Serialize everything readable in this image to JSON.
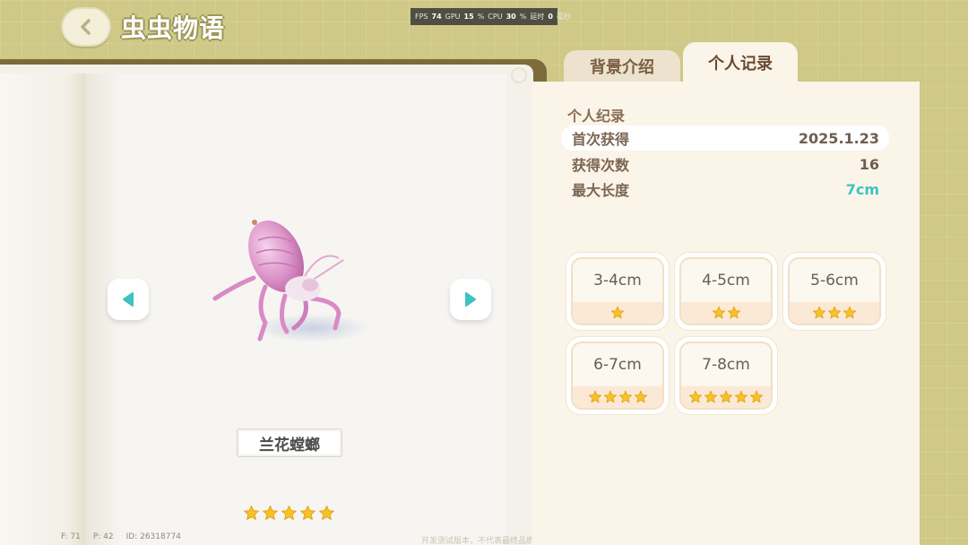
{
  "header": {
    "title": "虫虫物语",
    "back_icon": "chevron-left-icon"
  },
  "perf": {
    "fps_label": "FPS",
    "fps": "74",
    "gpu_label": "GPU",
    "gpu": "15",
    "cpu_label": "CPU",
    "cpu": "30",
    "latency_label": "延时",
    "latency": "0",
    "latency_unit": "毫秒",
    "percent": "%"
  },
  "insect": {
    "name": "兰花螳螂",
    "rarity_stars": 5
  },
  "nav": {
    "prev_icon": "triangle-left-icon",
    "next_icon": "triangle-right-icon"
  },
  "debug": {
    "f": "F: 71",
    "p": "P: 42",
    "id": "ID: 26318774"
  },
  "watermark": "开发测试版本，不代表最终品质",
  "tabs": [
    {
      "label": "背景介绍",
      "active": false
    },
    {
      "label": "个人记录",
      "active": true
    }
  ],
  "record": {
    "title": "个人纪录",
    "rows": [
      {
        "label": "首次获得",
        "value": "2025.1.23"
      },
      {
        "label": "获得次数",
        "value": "16"
      },
      {
        "label": "最大长度",
        "value": "7cm"
      }
    ]
  },
  "size_tiers": [
    {
      "label": "3-4cm",
      "stars": 1
    },
    {
      "label": "4-5cm",
      "stars": 2
    },
    {
      "label": "5-6cm",
      "stars": 3
    },
    {
      "label": "6-7cm",
      "stars": 4
    },
    {
      "label": "7-8cm",
      "stars": 5
    }
  ],
  "colors": {
    "background": "#cfc886",
    "panel": "#fbf4e8",
    "accent_teal": "#3fc2c1",
    "star": "#f5c22b"
  }
}
